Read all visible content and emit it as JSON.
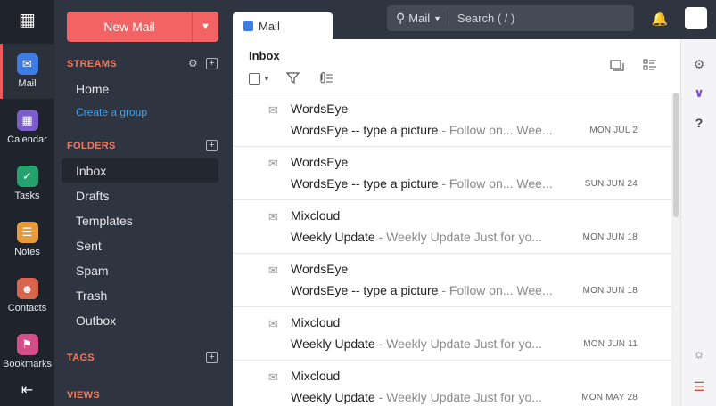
{
  "rail": {
    "apps": [
      {
        "label": "Mail",
        "icon": "mail-icon",
        "color": "#3d7be5",
        "active": true
      },
      {
        "label": "Calendar",
        "icon": "calendar-icon",
        "color": "#7b5ec9"
      },
      {
        "label": "Tasks",
        "icon": "tasks-icon",
        "color": "#25a36f"
      },
      {
        "label": "Notes",
        "icon": "notes-icon",
        "color": "#e89b3b"
      },
      {
        "label": "Contacts",
        "icon": "contacts-icon",
        "color": "#d9654f"
      },
      {
        "label": "Bookmarks",
        "icon": "bookmarks-icon",
        "color": "#d44f8a"
      }
    ]
  },
  "sidebar": {
    "new_mail_label": "New Mail",
    "streams_heading": "STREAMS",
    "home_label": "Home",
    "create_group_label": "Create a group",
    "folders_heading": "FOLDERS",
    "folders": [
      "Inbox",
      "Drafts",
      "Templates",
      "Sent",
      "Spam",
      "Trash",
      "Outbox"
    ],
    "tags_heading": "TAGS",
    "views_heading": "VIEWS"
  },
  "topbar": {
    "tab_label": "Mail",
    "search_scope": "Mail",
    "search_hint": "Search ( / )"
  },
  "panel": {
    "title": "Inbox",
    "emails": [
      {
        "sender": "WordsEye",
        "subject": "WordsEye -- type a picture",
        "preview": " - Follow on... Wee...",
        "date": "MON JUL 2"
      },
      {
        "sender": "WordsEye",
        "subject": "WordsEye -- type a picture",
        "preview": " - Follow on... Wee...",
        "date": "SUN JUN 24"
      },
      {
        "sender": "Mixcloud",
        "subject": "Weekly Update",
        "preview": " - Weekly Update Just for yo...",
        "date": "MON JUN 18"
      },
      {
        "sender": "WordsEye",
        "subject": "WordsEye -- type a picture",
        "preview": " - Follow on... Wee...",
        "date": "MON JUN 18"
      },
      {
        "sender": "Mixcloud",
        "subject": "Weekly Update",
        "preview": " - Weekly Update Just for yo...",
        "date": "MON JUN 11"
      },
      {
        "sender": "Mixcloud",
        "subject": "Weekly Update",
        "preview": " - Weekly Update Just for yo...",
        "date": "MON MAY 28"
      }
    ]
  },
  "util": {
    "help_label": "?"
  },
  "colors": {
    "accent": "#f46363",
    "link": "#3aa3f2",
    "section_heading": "#f07a5e"
  }
}
